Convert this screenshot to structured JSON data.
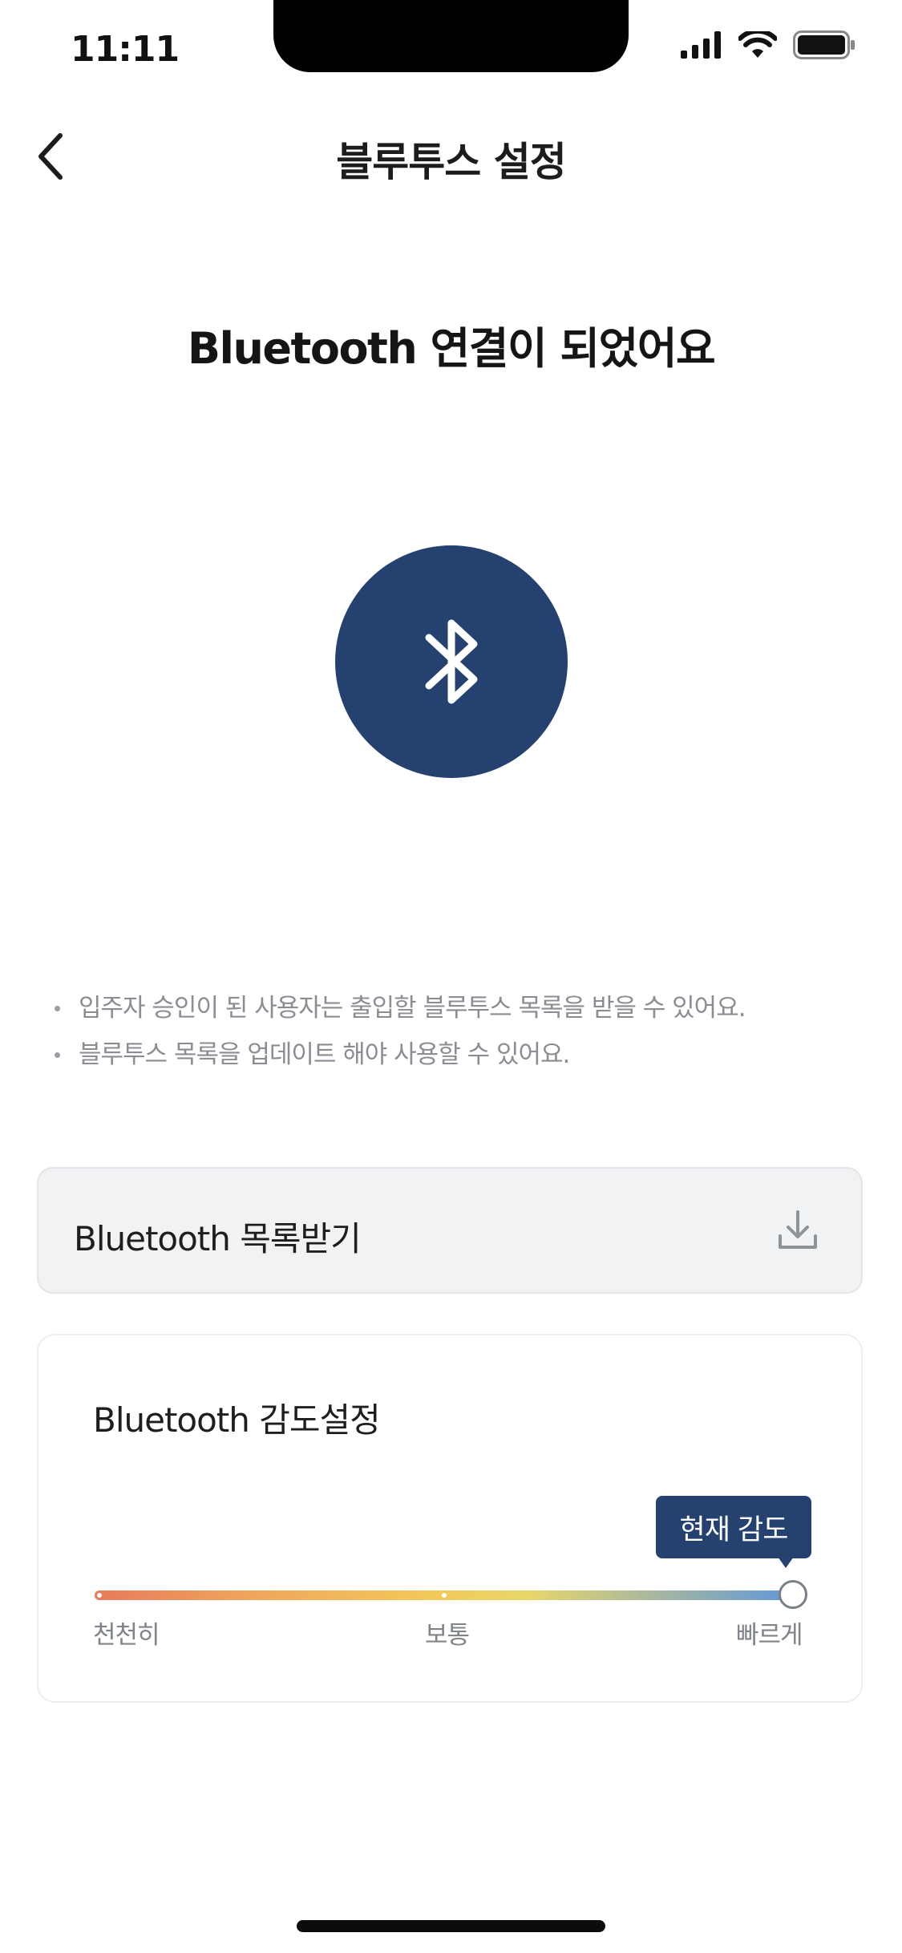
{
  "status_bar": {
    "time": "11:11"
  },
  "header": {
    "title": "블루투스 설정",
    "back_icon": "chevron-left-icon"
  },
  "main": {
    "heading": "Bluetooth 연결이 되었어요",
    "status_icon": "bluetooth-icon",
    "notes": [
      "입주자 승인이 된 사용자는 출입할 블루투스 목록을 받을 수 있어요.",
      "블루투스 목록을 업데이트 해야 사용할 수 있어요."
    ]
  },
  "download_card": {
    "label": "Bluetooth 목록받기",
    "icon": "download-icon"
  },
  "sensitivity_card": {
    "title": "Bluetooth 감도설정",
    "tooltip": "현재 감도",
    "labels": {
      "slow": "천천히",
      "normal": "보통",
      "fast": "빠르게"
    },
    "current_level": "fast",
    "current_value": 1.0
  },
  "colors": {
    "primary": "#244170",
    "card_bg": "#f1f2f4",
    "text_muted": "#8a8d94",
    "gradient": [
      "#e77a5c",
      "#f2c95a",
      "#5f98d8"
    ]
  }
}
